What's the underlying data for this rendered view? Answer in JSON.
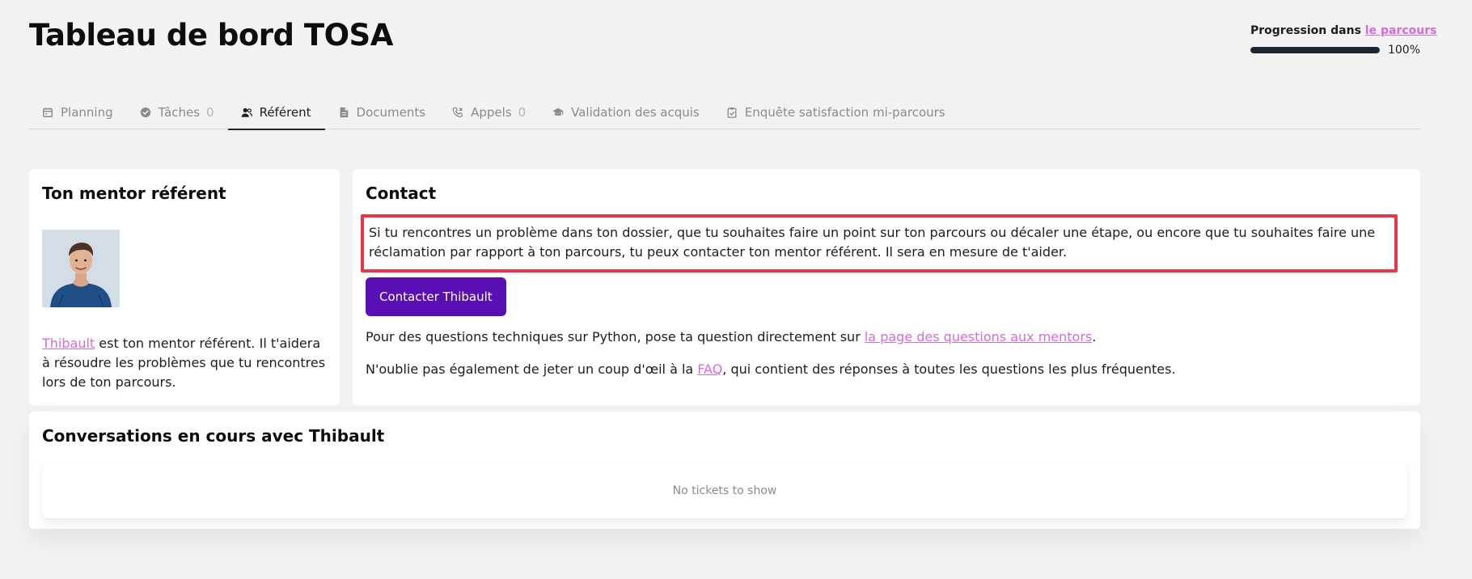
{
  "header": {
    "title": "Tableau de bord TOSA",
    "progress": {
      "label_prefix": "Progression dans ",
      "label_link": "le parcours",
      "value_text": "100%",
      "percent": 100
    }
  },
  "tabs": [
    {
      "label": "Planning",
      "icon": "calendar-icon",
      "count": "",
      "active": false
    },
    {
      "label": "Tâches",
      "icon": "check-circle-icon",
      "count": "0",
      "active": false
    },
    {
      "label": "Référent",
      "icon": "users-icon",
      "count": "",
      "active": true
    },
    {
      "label": "Documents",
      "icon": "document-icon",
      "count": "",
      "active": false
    },
    {
      "label": "Appels",
      "icon": "phone-icon",
      "count": "0",
      "active": false
    },
    {
      "label": "Validation des acquis",
      "icon": "graduation-cap-icon",
      "count": "",
      "active": false
    },
    {
      "label": "Enquête satisfaction mi-parcours",
      "icon": "clipboard-icon",
      "count": "",
      "active": false
    }
  ],
  "mentor_card": {
    "title": "Ton mentor référent",
    "mentor_name": "Thibault",
    "description": " est ton mentor référent. Il t'aidera à résoudre les problèmes que tu rencontres lors de ton parcours."
  },
  "contact_card": {
    "title": "Contact",
    "intro": "Si tu rencontres un problème dans ton dossier, que tu souhaites faire un point sur ton parcours ou décaler une étape, ou encore que tu souhaites faire une réclamation par rapport à ton parcours, tu peux contacter ton mentor référent. Il sera en mesure de t'aider.",
    "button_label": "Contacter Thibault",
    "questions_prefix": "Pour des questions techniques sur Python, pose ta question directement sur ",
    "questions_link": "la page des questions aux mentors",
    "questions_suffix": ".",
    "faq_prefix": "N'oublie pas également de jeter un coup d'œil à la ",
    "faq_link": "FAQ",
    "faq_suffix": ", qui contient des réponses à toutes les questions les plus fréquentes."
  },
  "conversations": {
    "title": "Conversations en cours avec Thibault",
    "empty_text": "No tickets to show"
  },
  "colors": {
    "accent_purple": "#5a0fb4",
    "link_pink": "#d46bd9",
    "highlight_red": "#e8374a",
    "progress_dark": "#1e2533"
  }
}
